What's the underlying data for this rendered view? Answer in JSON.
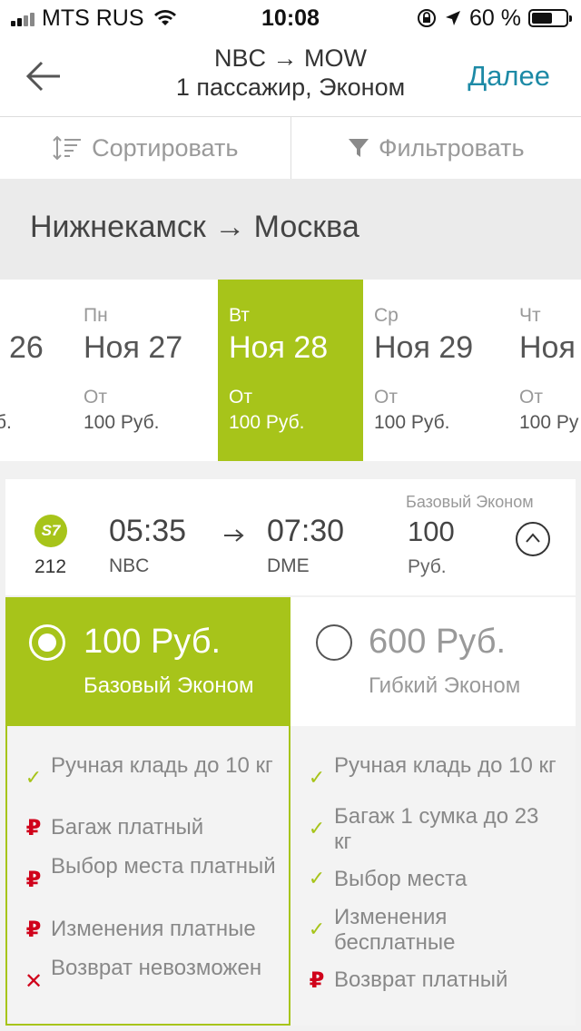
{
  "status_bar": {
    "carrier": "MTS RUS",
    "time": "10:08",
    "battery": "60 %",
    "battery_level": 0.6
  },
  "header": {
    "title": "NBC → MOW",
    "subtitle": "1 пассажир, Эконом",
    "next_label": "Далее"
  },
  "toolbar": {
    "sort_label": "Сортировать",
    "filter_label": "Фильтровать"
  },
  "route": {
    "text": "Нижнекамск → Москва"
  },
  "dates": [
    {
      "dow": "",
      "dm": "26",
      "from": "",
      "price": "б."
    },
    {
      "dow": "Пн",
      "dm": "Ноя 27",
      "from": "От",
      "price": "100 Руб."
    },
    {
      "dow": "Вт",
      "dm": "Ноя 28",
      "from": "От",
      "price": "100 Руб.",
      "selected": true
    },
    {
      "dow": "Ср",
      "dm": "Ноя 29",
      "from": "От",
      "price": "100 Руб."
    },
    {
      "dow": "Чт",
      "dm": "Ноя",
      "from": "От",
      "price": "100 Ру"
    }
  ],
  "flight": {
    "airline_logo": "S7",
    "number": "212",
    "dep_time": "05:35",
    "dep_code": "NBC",
    "arr_time": "07:30",
    "arr_code": "DME",
    "fare_name": "Базовый Эконом",
    "fare_price": "100",
    "fare_currency": "Руб."
  },
  "fares": [
    {
      "price": "100 Руб.",
      "name": "Базовый Эконом",
      "selected": true,
      "features": [
        {
          "icon": "check",
          "text": "Ручная кладь до 10 кг"
        },
        {
          "icon": "ruble",
          "text": "Багаж платный"
        },
        {
          "icon": "ruble",
          "text": "Выбор места платный"
        },
        {
          "icon": "ruble",
          "text": "Изменения платные"
        },
        {
          "icon": "cross",
          "text": "Возврат невозможен"
        }
      ]
    },
    {
      "price": "600 Руб.",
      "name": "Гибкий Эконом",
      "selected": false,
      "features": [
        {
          "icon": "check",
          "text": "Ручная кладь до 10 кг"
        },
        {
          "icon": "check",
          "text": "Багаж 1 сумка до 23 кг"
        },
        {
          "icon": "check",
          "text": "Выбор места"
        },
        {
          "icon": "check",
          "text": "Изменения бесплатные"
        },
        {
          "icon": "ruble",
          "text": "Возврат платный"
        }
      ]
    }
  ],
  "colors": {
    "accent": "#a7c41a",
    "link": "#1d8aa6",
    "warning": "#d0021b"
  }
}
